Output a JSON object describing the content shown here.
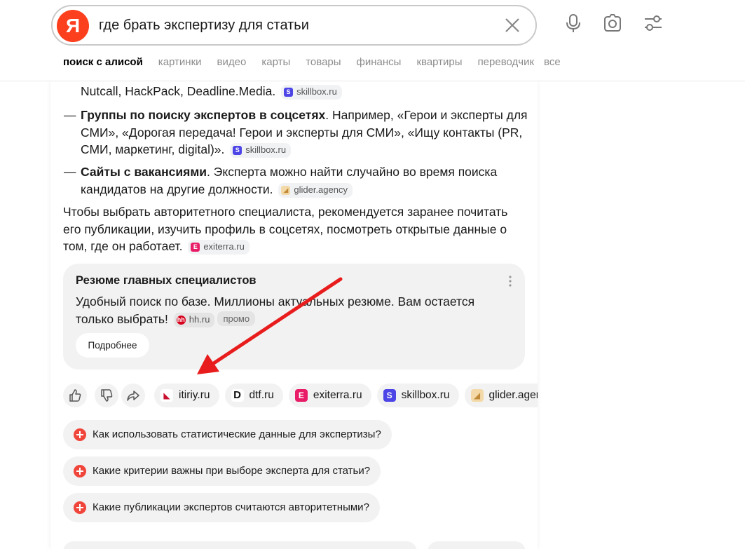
{
  "search": {
    "logo": "Я",
    "query": "где брать экспертизу для статьи"
  },
  "tabs": [
    "поиск с алисой",
    "картинки",
    "видео",
    "карты",
    "товары",
    "финансы",
    "квартиры",
    "переводчик",
    "все"
  ],
  "answer": {
    "line_top": "Nutcall, HackPack, Deadline.Media.",
    "item2_bold": "Группы по поиску экспертов в соцсетях",
    "item2_text1": ". Например, «Герои и эксперты для",
    "item2_text2": "СМИ», «Дорогая передача! Герои и эксперты для СМИ», «Ищу контакты (PR,",
    "item2_text3": "СМИ, маркетинг, digital)».",
    "item3_bold": "Сайты с вакансиями",
    "item3_text1": ". Эксперта можно найти случайно во время поиска",
    "item3_text2": "кандидатов на другие должности.",
    "para1": "Чтобы выбрать авторитетного специалиста, рекомендуется заранее почитать",
    "para2": "его публикации, изучить профиль в соцсетях, посмотреть открытые данные о",
    "para3": "том, где он работает.",
    "dash": "—",
    "sources": {
      "skillbox": "skillbox.ru",
      "glider": "glider.agency",
      "exiterra": "exiterra.ru"
    }
  },
  "ad": {
    "title": "Резюме главных специалистов",
    "text1": "Удобный поиск по базе. Миллионы актуальных резюме. Вам остается",
    "text2": "только выбрать!",
    "source": "hh.ru",
    "promo": "промо",
    "more": "Подробнее"
  },
  "chips": [
    "itiriy.ru",
    "dtf.ru",
    "exiterra.ru",
    "skillbox.ru",
    "glider.agency"
  ],
  "questions": [
    "Как использовать статистические данные для экспертизы?",
    "Какие критерии важны при выборе эксперта для статьи?",
    "Какие публикации экспертов считаются авторитетными?"
  ],
  "colors": {
    "accent_red": "#fc3f1d",
    "arrow": "#e81c1c"
  }
}
